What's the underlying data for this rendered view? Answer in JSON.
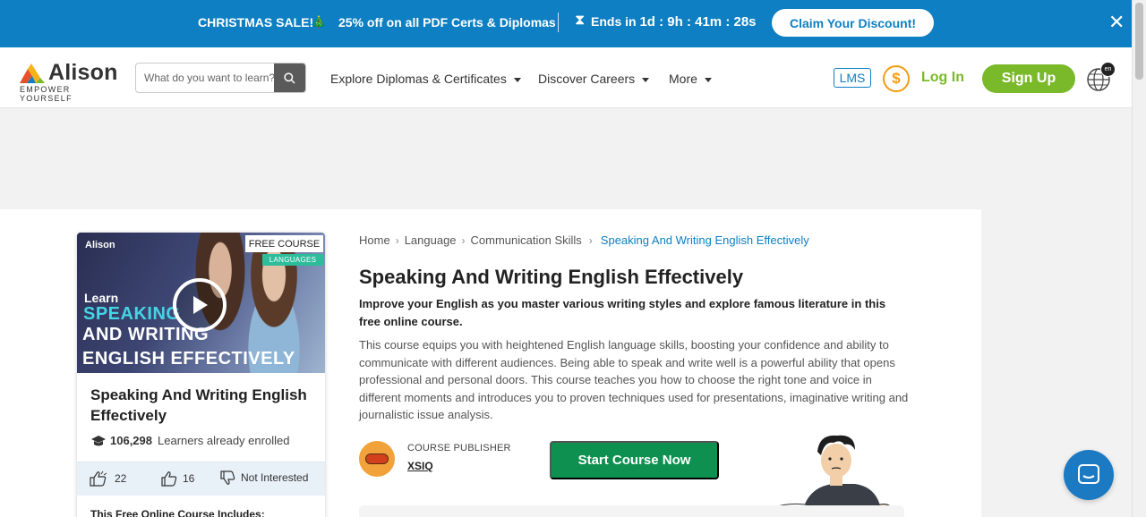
{
  "promo": {
    "sale_label": "CHRISTMAS SALE!",
    "offer_text": "25% off on all PDF Certs & Diplomas",
    "ends_prefix": "Ends in",
    "countdown": "1d : 9h : 41m : 28s",
    "cta_label": "Claim Your Discount!",
    "close_icon": "close-icon"
  },
  "header": {
    "logo": {
      "name": "Alison",
      "tagline": "EMPOWER YOURSELF"
    },
    "search": {
      "placeholder": "What do you want to learn?",
      "value": ""
    },
    "nav": [
      {
        "label": "Explore Diplomas & Certificates"
      },
      {
        "label": "Discover Careers"
      },
      {
        "label": "More"
      }
    ],
    "lms_label": "LMS",
    "dollar_symbol": "$",
    "login_label": "Log In",
    "signup_label": "Sign Up",
    "language_badge": "en"
  },
  "card": {
    "thumbnail": {
      "brand": "Alison",
      "free_badge": "FREE COURSE",
      "category_badge": "LANGUAGES",
      "line1": "Learn",
      "line2": "SPEAKING",
      "line3": "AND WRITING",
      "line4": "ENGLISH EFFECTIVELY"
    },
    "title": "Speaking And Writing English Effectively",
    "enrolled_count": "106,298",
    "enrolled_text": "Learners already enrolled",
    "likes": "22",
    "dislikes": "16",
    "not_interested": "Not Interested",
    "includes_heading": "This Free Online Course Includes:"
  },
  "course": {
    "breadcrumb": [
      "Home",
      "Language",
      "Communication Skills",
      "Speaking And Writing English Effectively"
    ],
    "title": "Speaking And Writing English Effectively",
    "subtitle": "Improve your English as you master various writing styles and explore famous literature in this free online course.",
    "description": "This course equips you with heightened English language skills, boosting your confidence and ability to communicate with different audiences. Being able to speak and write well is a powerful ability that opens professional and personal doors. This course teaches you how to choose the right tone and voice in different moments and introduces you to proven techniques used for presentations, imaginative writing and journalistic issue analysis.",
    "publisher_label": "COURSE PUBLISHER",
    "publisher_name": "XSIQ",
    "start_label": "Start Course Now"
  },
  "colors": {
    "brand_blue": "#0d7fc2",
    "brand_green": "#7ab929",
    "start_green": "#0e9150"
  }
}
